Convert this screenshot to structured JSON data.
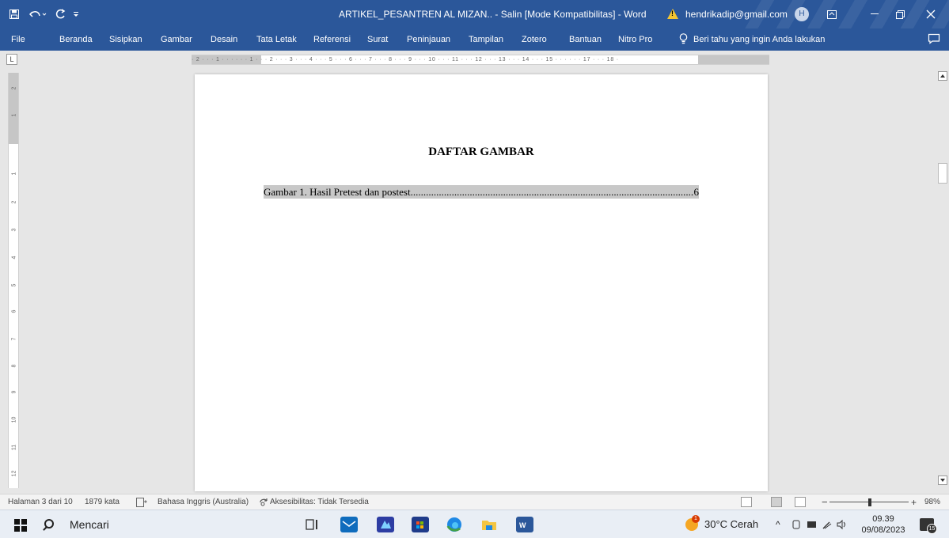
{
  "titlebar": {
    "document_title": "ARTIKEL_PESANTREN AL MIZAN.. - Salin [Mode Kompatibilitas] - Word",
    "account_email": "hendrikadip@gmail.com",
    "avatar_initial": "H",
    "warning_mark": "!",
    "save_icon": "save-icon",
    "undo_icon": "undo-icon",
    "redo_icon": "redo-icon"
  },
  "ribbon": {
    "tabs": [
      "File",
      "Beranda",
      "Sisipkan",
      "Gambar",
      "Desain",
      "Tata Letak",
      "Referensi",
      "Surat",
      "Peninjauan",
      "Tampilan",
      "Zotero",
      "Bantuan",
      "Nitro Pro"
    ],
    "tell_me": "Beri tahu yang ingin Anda lakukan"
  },
  "ruler": {
    "corner_label": "L",
    "horizontal_ticks": "· 2 · · · 1 · · ·   · · · 1 · · · 2 · · · 3 · · · 4 · · · 5 · · · 6 · · · 7 · · · 8 · · · 9 · · · 10 · · · 11 · · · 12 · · · 13 · · · 14 · · · 15 · · ·   · · · 17 · · · 18 ·",
    "vertical_ticks": [
      "2",
      "1",
      "1",
      "2",
      "3",
      "4",
      "5",
      "6",
      "7",
      "8",
      "9",
      "10",
      "11",
      "12"
    ]
  },
  "document": {
    "heading": "DAFTAR GAMBAR",
    "toc_entry": {
      "text": "Gambar 1. Hasil Pretest dan postest",
      "page": "6"
    }
  },
  "statusbar": {
    "page_info": "Halaman 3 dari 10",
    "word_count": "1879 kata",
    "language": "Bahasa Inggris (Australia)",
    "accessibility": "Aksesibilitas: Tidak Tersedia",
    "zoom_minus": "−",
    "zoom_plus": "+",
    "zoom_level": "98%",
    "zoom_fraction": 0.49
  },
  "taskbar": {
    "search_label": "Mencari",
    "weather": "30°C  Cerah",
    "time": "09.39",
    "date": "09/08/2023",
    "notification_count": "15",
    "tray_chevron": "^"
  }
}
